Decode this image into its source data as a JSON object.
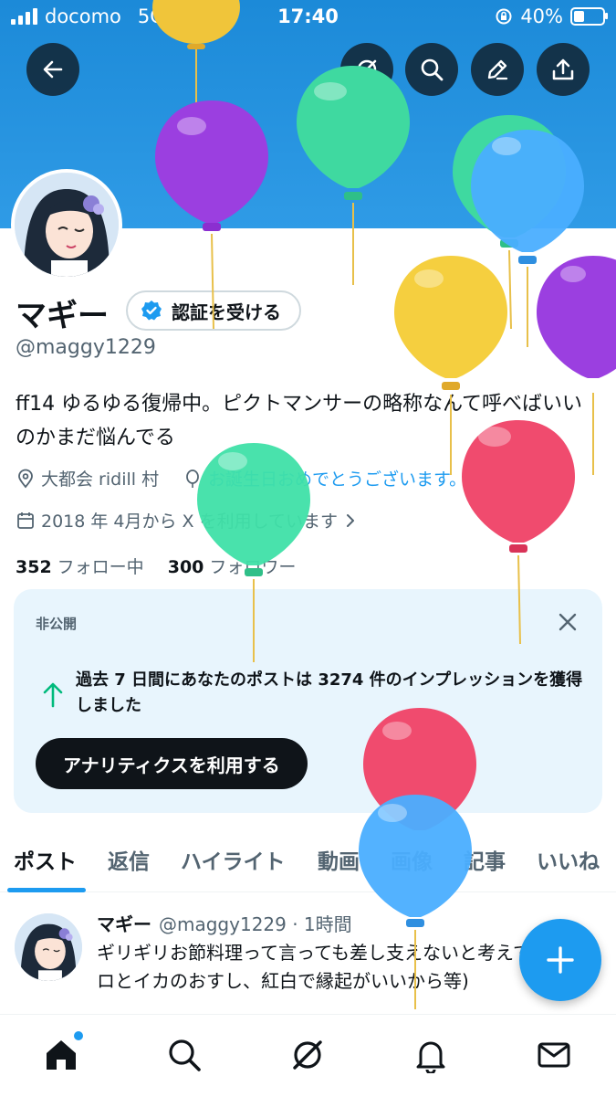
{
  "status_bar": {
    "carrier": "docomo",
    "network": "5G",
    "time": "17:40",
    "battery": "40%"
  },
  "header_actions": [
    "back-icon",
    "grok-icon",
    "search-icon",
    "edit-icon",
    "share-icon"
  ],
  "profile": {
    "name": "マギー",
    "verify_label": "認証を受ける",
    "handle": "@maggy1229",
    "bio": "ff14 ゆるゆる復帰中。ピクトマンサーの略称なんて呼べばいいのかまだ悩んでる",
    "location": "大都会 ridill 村",
    "birthday": "お誕生日おめでとうございます。",
    "joined": "2018 年 4月から X を利用しています",
    "following_count": "352",
    "following_label": "フォロー中",
    "followers_count": "300",
    "followers_label": "フォロワー"
  },
  "analytics_card": {
    "private_label": "非公開",
    "message": "過去 7 日間にあなたのポストは 3274 件のインプレッションを獲得しました",
    "cta": "アナリティクスを利用する"
  },
  "tabs": [
    "ポスト",
    "返信",
    "ハイライト",
    "動画",
    "画像",
    "記事",
    "いいね"
  ],
  "active_tab": "ポスト",
  "post": {
    "name": "マギー",
    "handle_time": "@maggy1229 · 1時間",
    "text": "ギリギリお節料理って言っても差し支えないと考えて(例:マグロとイカのおすし、紅白で縁起がいいから等)"
  },
  "bottom_nav": [
    "home-icon",
    "search-icon",
    "grok-icon",
    "notifications-icon",
    "messages-icon"
  ],
  "colors": {
    "accent": "#1d9bf0",
    "banner": "#1c8ad8",
    "text": "#0f1419",
    "muted": "#536471",
    "card": "#e8f5fd"
  }
}
